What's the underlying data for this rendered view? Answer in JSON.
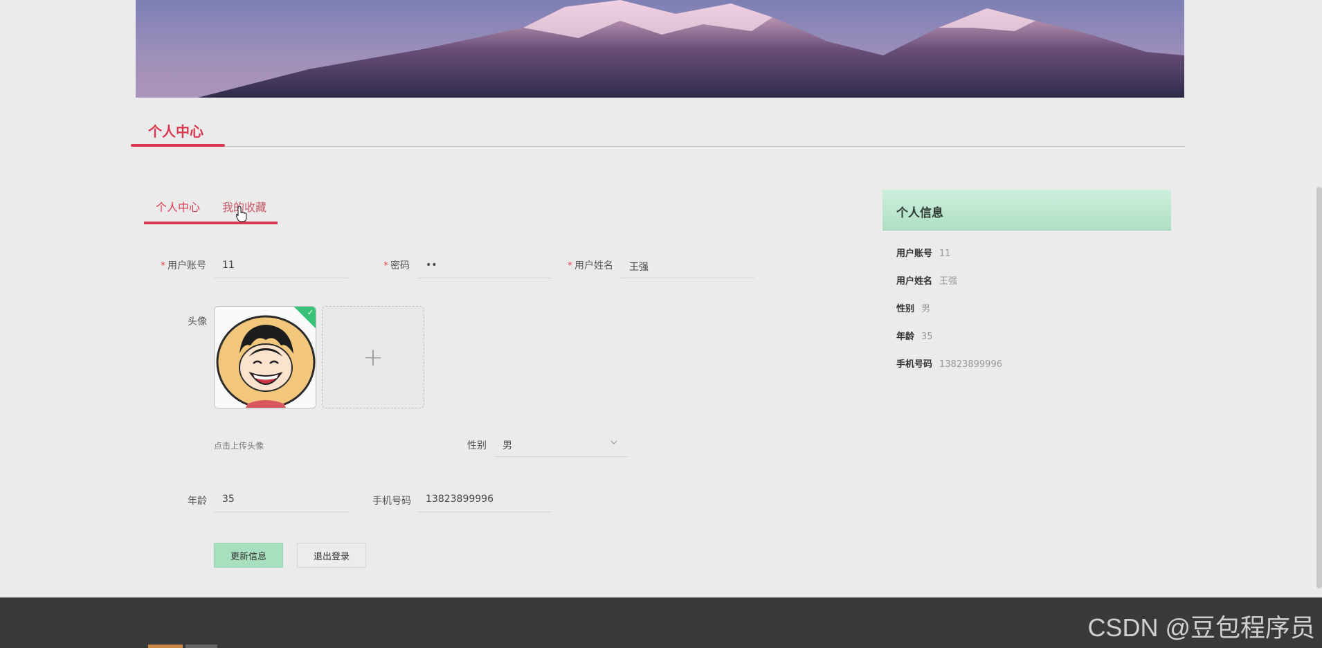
{
  "page": {
    "section_title": "个人中心"
  },
  "tabs": [
    {
      "label": "个人中心"
    },
    {
      "label": "我的收藏"
    }
  ],
  "form": {
    "account_label": "用户账号",
    "account_value": "11",
    "password_label": "密码",
    "password_value": "••",
    "username_label": "用户姓名",
    "username_value": "王强",
    "avatar_label": "头像",
    "upload_hint": "点击上传头像",
    "gender_label": "性别",
    "gender_value": "男",
    "age_label": "年龄",
    "age_value": "35",
    "phone_label": "手机号码",
    "phone_value": "13823899996",
    "update_button": "更新信息",
    "logout_button": "退出登录"
  },
  "info_panel": {
    "title": "个人信息",
    "rows": [
      {
        "key": "用户账号",
        "value": "11"
      },
      {
        "key": "用户姓名",
        "value": "王强"
      },
      {
        "key": "性别",
        "value": "男"
      },
      {
        "key": "年龄",
        "value": "35"
      },
      {
        "key": "手机号码",
        "value": "13823899996"
      }
    ]
  },
  "watermark": "CSDN @豆包程序员",
  "colors": {
    "accent": "#d8384f",
    "green": "#a8dfbf",
    "footer": "#3a3a3a",
    "page_bg": "#ebebeb"
  },
  "icons": [
    "check-icon",
    "plus-icon",
    "chevron-down-icon",
    "pointer-cursor-icon"
  ]
}
